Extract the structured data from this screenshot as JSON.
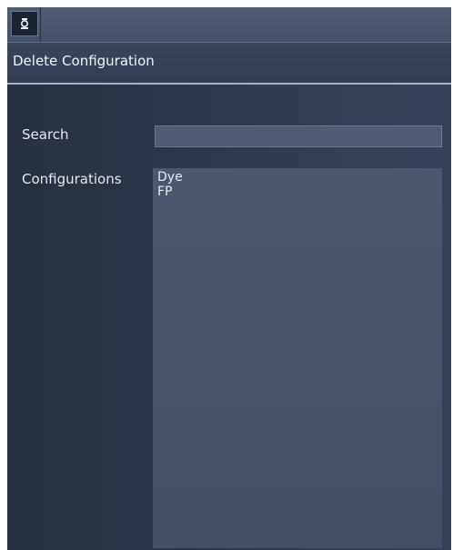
{
  "toolbar": {
    "app_icon": "microscope-icon"
  },
  "dialog": {
    "title": "Delete Configuration",
    "search_label": "Search",
    "search_value": "",
    "search_placeholder": "",
    "configurations_label": "Configurations",
    "configurations": [
      "Dye",
      "FP"
    ]
  }
}
